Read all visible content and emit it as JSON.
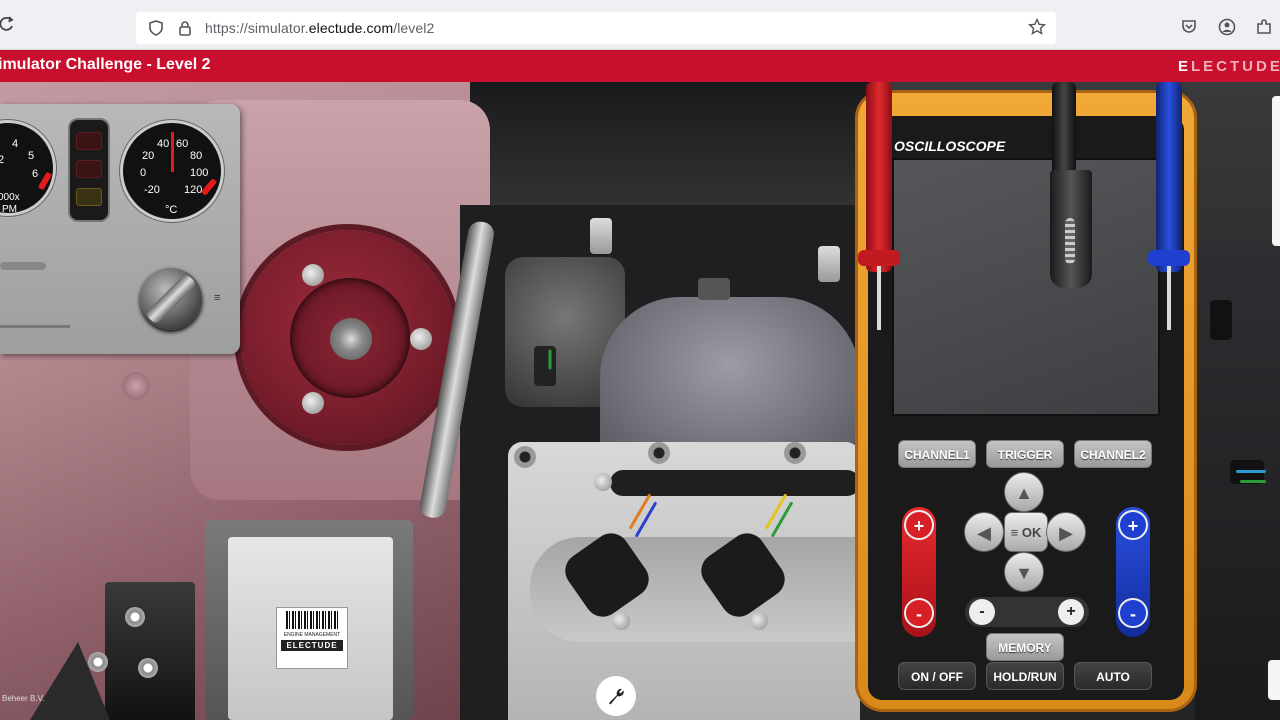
{
  "browser": {
    "url_prefix": "https://simulator.",
    "url_domain": "electude.com",
    "url_path": "/level2"
  },
  "app": {
    "title": "imulator Challenge - Level 2",
    "brand_first": "E",
    "brand_rest": "LECTUDE"
  },
  "dashboard": {
    "rpm_ticks": [
      "4",
      "5",
      "6",
      "2"
    ],
    "rpm_unit_line1": "000x",
    "rpm_unit_line2": "PM",
    "temp_ticks": [
      "40",
      "60",
      "20",
      "80",
      "0",
      "100",
      "-20",
      "120"
    ],
    "temp_unit": "°C",
    "fan_symbol": "≡"
  },
  "ecu": {
    "label_line": "ENGINE MANAGEMENT",
    "brand": "ELECTUDE"
  },
  "footer": {
    "text": "Beheer B.V."
  },
  "oscilloscope": {
    "title": "OSCILLOSCOPE",
    "channel1": "CHANNEL1",
    "trigger": "TRIGGER",
    "channel2": "CHANNEL2",
    "ok": "≡ OK",
    "memory": "MEMORY",
    "on_off": "ON / OFF",
    "hold_run": "HOLD/RUN",
    "auto": "AUTO",
    "plus": "+",
    "minus": "-",
    "up": "▲",
    "down": "▼",
    "left": "◀",
    "right": "▶"
  },
  "colors": {
    "brand_red": "#c8102e",
    "scope_orange": "#f1a836",
    "channel1_red": "#d81f26",
    "channel2_blue": "#1f3fd1"
  },
  "icons": {
    "reload": "reload-icon",
    "shield": "shield-icon",
    "lock": "lock-icon",
    "star": "star-icon",
    "pocket": "pocket-icon",
    "account": "account-icon",
    "extensions": "extensions-icon",
    "wrench": "wrench-icon"
  }
}
